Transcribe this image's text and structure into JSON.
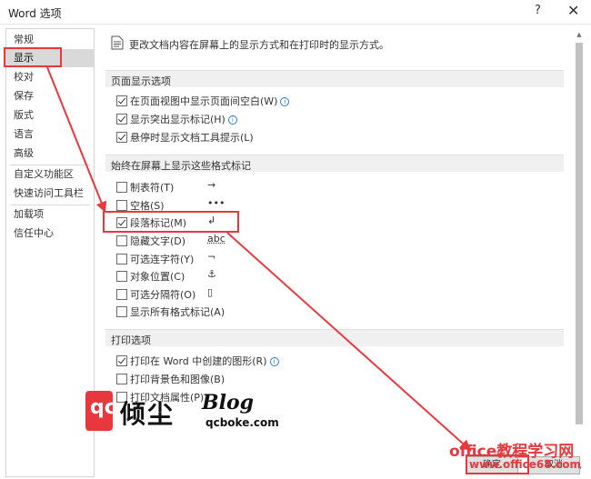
{
  "window": {
    "title": "Word 选项",
    "help": "?",
    "close": "✕"
  },
  "sidebar": {
    "items": [
      {
        "label": "常规"
      },
      {
        "label": "显示"
      },
      {
        "label": "校对"
      },
      {
        "label": "保存"
      },
      {
        "label": "版式"
      },
      {
        "label": "语言"
      },
      {
        "label": "高级"
      },
      {
        "label": "自定义功能区"
      },
      {
        "label": "快速访问工具栏"
      },
      {
        "label": "加载项"
      },
      {
        "label": "信任中心"
      }
    ]
  },
  "intro": "更改文档内容在屏幕上的显示方式和在打印时的显示方式。",
  "sections": {
    "page": "页面显示选项",
    "marks": "始终在屏幕上显示这些格式标记",
    "print": "打印选项"
  },
  "page_options": [
    {
      "label": "在页面视图中显示页面间空白(W)",
      "checked": true,
      "info": true
    },
    {
      "label": "显示突出显示标记(H)",
      "checked": true,
      "info": true
    },
    {
      "label": "悬停时显示文档工具提示(L)",
      "checked": true,
      "info": false
    }
  ],
  "mark_options": [
    {
      "label": "制表符(T)",
      "symbol": "→",
      "checked": false
    },
    {
      "label": "空格(S)",
      "symbol": "•••",
      "checked": false
    },
    {
      "label": "段落标记(M)",
      "symbol": "↲",
      "checked": true
    },
    {
      "label": "隐藏文字(D)",
      "symbol": "abc",
      "checked": false
    },
    {
      "label": "可选连字符(Y)",
      "symbol": "¬",
      "checked": false
    },
    {
      "label": "对象位置(C)",
      "symbol": "⚓",
      "checked": false
    },
    {
      "label": "可选分隔符(O)",
      "symbol": "▯",
      "checked": false
    },
    {
      "label": "显示所有格式标记(A)",
      "symbol": "",
      "checked": false
    }
  ],
  "print_options": [
    {
      "label": "打印在 Word 中创建的图形(R)",
      "checked": true,
      "info": true
    },
    {
      "label": "打印背景色和图像(B)",
      "checked": false,
      "info": false
    },
    {
      "label": "打印文档属性(P)",
      "checked": false,
      "info": false
    }
  ],
  "watermark": {
    "logo": "qc",
    "cn": "倾尘",
    "blog": "Blog",
    "url": "qcboke.com"
  },
  "office_watermark": {
    "title": "office教程学习网",
    "url": "www.office68.com"
  },
  "buttons": {
    "ok": "确定",
    "cancel": "取消"
  },
  "colors": {
    "highlight": "#e8383d",
    "selected_nav": "#d9d9d9",
    "section_bg": "#f0f0f0"
  }
}
